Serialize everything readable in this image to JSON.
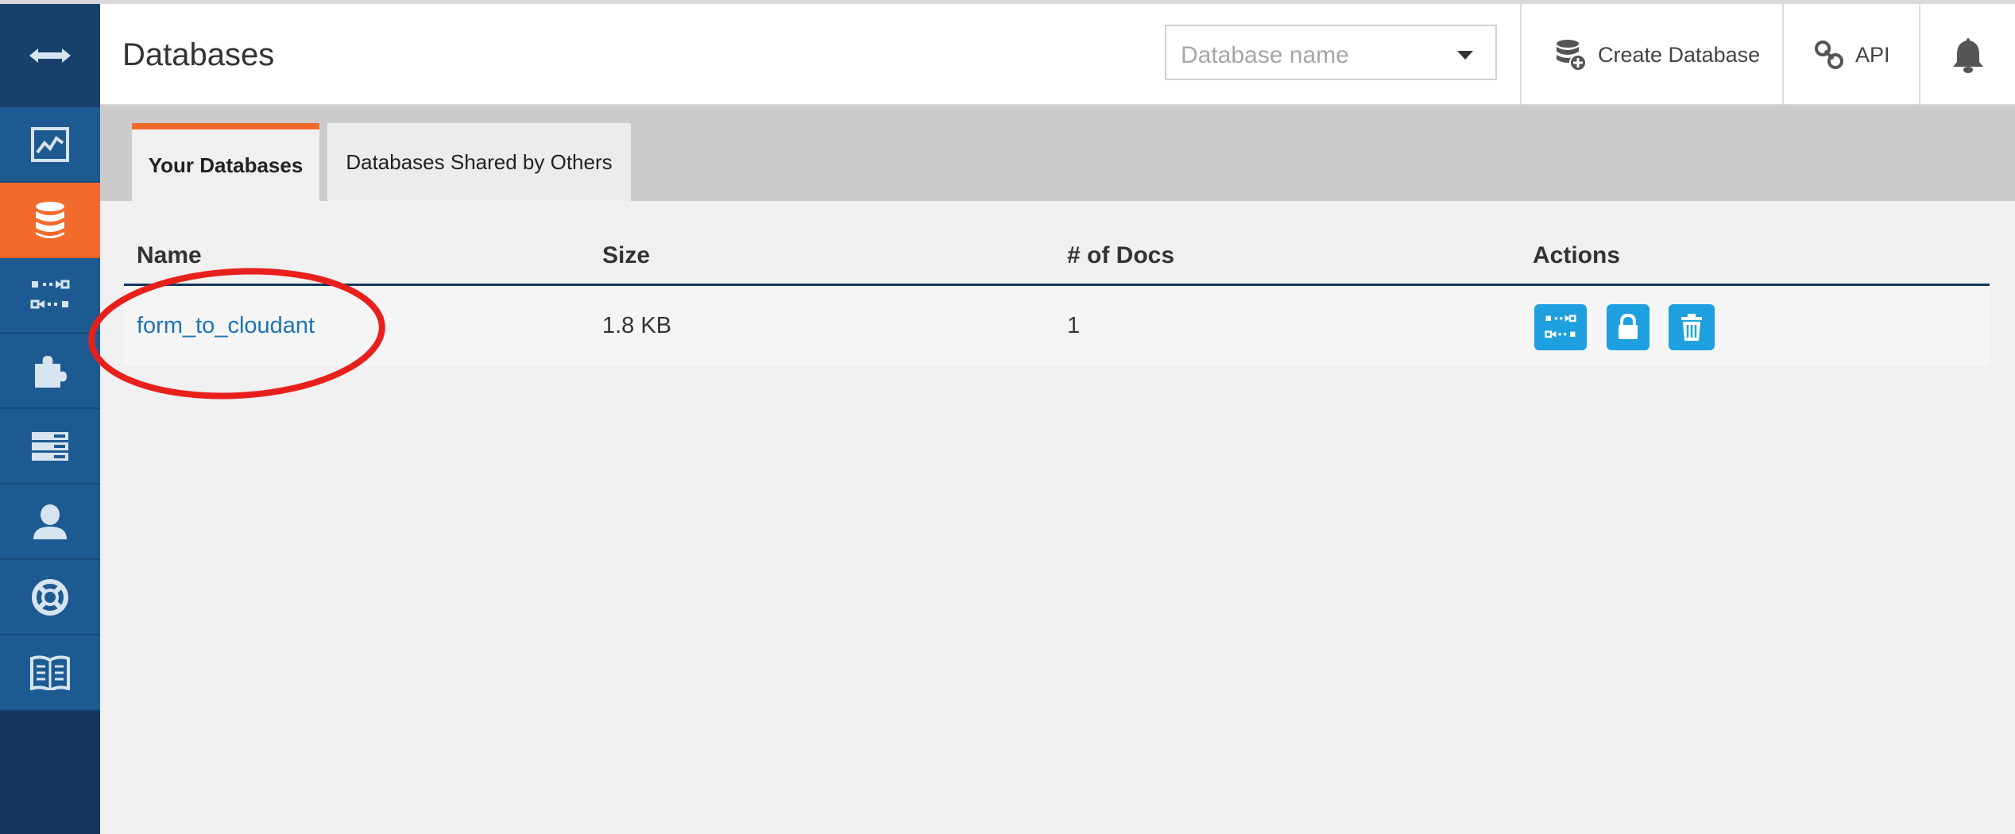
{
  "header": {
    "title": "Databases",
    "search_placeholder": "Database name",
    "create_label": "Create Database",
    "api_label": "API"
  },
  "tabs": [
    {
      "label": "Your Databases",
      "active": true
    },
    {
      "label": "Databases Shared by Others",
      "active": false
    }
  ],
  "table": {
    "columns": [
      "Name",
      "Size",
      "# of Docs",
      "Actions"
    ],
    "rows": [
      {
        "name": "form_to_cloudant",
        "size": "1.8 KB",
        "docs": "1"
      }
    ]
  },
  "sidebar": {
    "items": [
      {
        "icon": "chart-icon"
      },
      {
        "icon": "database-icon",
        "active": true
      },
      {
        "icon": "replication-icon"
      },
      {
        "icon": "puzzle-icon"
      },
      {
        "icon": "server-icon"
      },
      {
        "icon": "user-icon"
      },
      {
        "icon": "lifebuoy-icon"
      },
      {
        "icon": "book-icon"
      }
    ]
  },
  "colors": {
    "sidebar": "#1e5a92",
    "sidebar_dark": "#15355c",
    "accent": "#f26b2c",
    "action_button": "#1ea0e0",
    "link": "#1d73b8",
    "annotation": "#e8201c"
  }
}
